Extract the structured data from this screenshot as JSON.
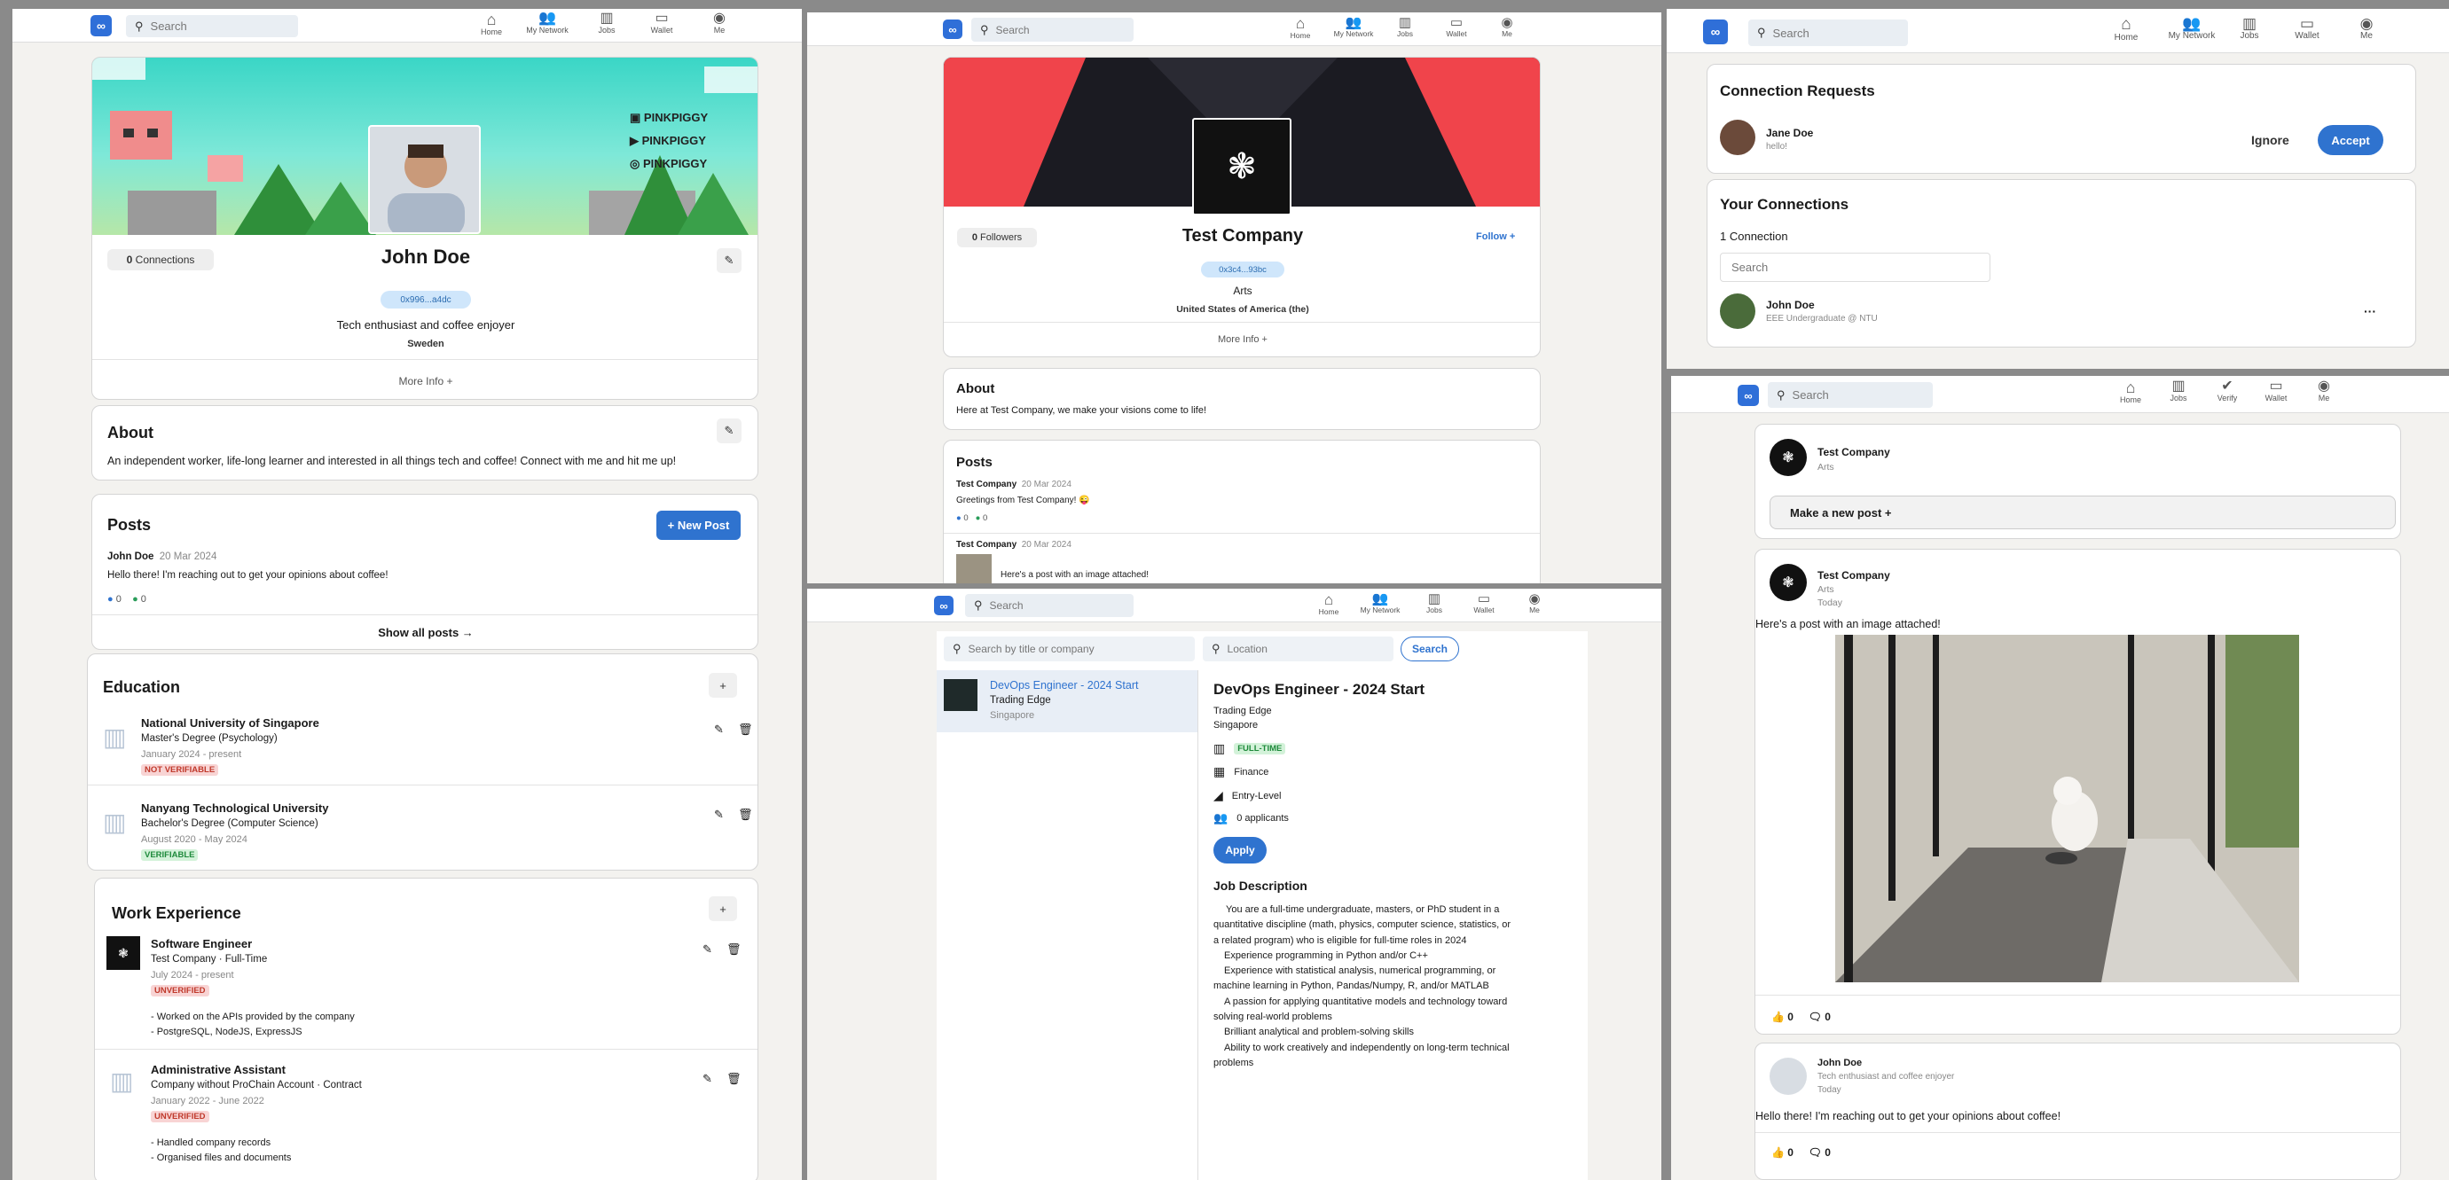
{
  "colors": {
    "brand": "#2f6fd8",
    "accent": "#2f73cf",
    "unverified": "#c0392b",
    "verifiable": "#1e8a3b"
  },
  "nav": {
    "search_placeholder": "Search",
    "home": "Home",
    "network": "My Network",
    "jobs": "Jobs",
    "wallet": "Wallet",
    "me": "Me",
    "verify": "Verify"
  },
  "profile": {
    "connections_count": "0",
    "connections_label": "Connections",
    "name": "John Doe",
    "wallet": "0x996...a4dc",
    "headline": "Tech enthusiast and coffee enjoyer",
    "location": "Sweden",
    "more_info": "More Info +",
    "banner_social": [
      "PINKPIGGY",
      "PINKPIGGY",
      "PINKPIGGY"
    ],
    "about_title": "About",
    "about_text": "An independent worker, life-long learner and interested in all things tech and coffee! Connect with me and hit me up!",
    "posts_title": "Posts",
    "new_post": "+ New Post",
    "post_author": "John Doe",
    "post_date": "20 Mar 2024",
    "post_text": "Hello there! I'm reaching out to get your opinions about coffee!",
    "post_likes": "0",
    "post_comments": "0",
    "show_all": "Show all posts →",
    "education_title": "Education",
    "education": [
      {
        "school": "National University of Singapore",
        "degree": "Master's Degree (Psychology)",
        "dates": "January 2024 - present",
        "status": "NOT VERIFIABLE"
      },
      {
        "school": "Nanyang Technological University",
        "degree": "Bachelor's Degree (Computer Science)",
        "dates": "August 2020 - May 2024",
        "status": "VERIFIABLE"
      }
    ],
    "work_title": "Work Experience",
    "work": [
      {
        "role": "Software Engineer",
        "company": "Test Company · Full-Time",
        "dates": "July 2024 - present",
        "status": "UNVERIFIED",
        "bullets": [
          "- Worked on the APIs provided by the company",
          "- PostgreSQL, NodeJS, ExpressJS"
        ]
      },
      {
        "role": "Administrative Assistant",
        "company": "Company without ProChain Account · Contract",
        "dates": "January 2022 - June 2022",
        "status": "UNVERIFIED",
        "bullets": [
          "- Handled company records",
          "- Organised files and documents"
        ]
      }
    ]
  },
  "company": {
    "followers_count": "0",
    "followers_label": "Followers",
    "name": "Test Company",
    "follow": "Follow +",
    "wallet": "0x3c4...93bc",
    "industry": "Arts",
    "country": "United States of America (the)",
    "more_info": "More Info +",
    "about_title": "About",
    "about_text": "Here at Test Company, we make your visions come to life!",
    "posts_title": "Posts",
    "post1_author": "Test Company",
    "post1_date": "20 Mar 2024",
    "post1_text": "Greetings from Test Company! 😜",
    "post1_likes": "0",
    "post1_comments": "0",
    "post2_author": "Test Company",
    "post2_date": "20 Mar 2024",
    "post2_text": "Here's a post with an image attached!"
  },
  "jobs": {
    "search_placeholder": "Search by title or company",
    "location_placeholder": "Location",
    "search_btn": "Search",
    "list_title": "DevOps Engineer - 2024 Start",
    "list_company": "Trading Edge",
    "list_location": "Singapore",
    "title": "DevOps Engineer - 2024 Start",
    "company": "Trading Edge",
    "location": "Singapore",
    "type": "FULL-TIME",
    "industry": "Finance",
    "level": "Entry-Level",
    "applicants": "0 applicants",
    "apply": "Apply",
    "desc_title": "Job Description",
    "desc_lines": [
      "You are a full-time undergraduate, masters, or PhD student in a",
      "quantitative discipline (math, physics, computer science, statistics, or",
      "a related program) who is eligible for full-time roles in 2024",
      "Experience programming in Python and/or C++",
      "Experience with statistical analysis, numerical programming, or",
      "machine learning in Python, Pandas/Numpy, R, and/or MATLAB",
      "A passion for applying quantitative models and technology toward",
      "solving real-world problems",
      "Brilliant analytical and problem-solving skills",
      "Ability to work creatively and independently on long-term technical",
      "problems"
    ]
  },
  "network": {
    "requests_title": "Connection Requests",
    "req_name": "Jane Doe",
    "req_msg": "hello!",
    "ignore": "Ignore",
    "accept": "Accept",
    "connections_title": "Your Connections",
    "connections_count": "1 Connection",
    "search_placeholder": "Search",
    "conn_name": "John Doe",
    "conn_headline": "EEE Undergraduate @ NTU",
    "more": "···"
  },
  "feed": {
    "new_name": "Test Company",
    "new_sub": "Arts",
    "new_post_btn": "Make a new post +",
    "p1_name": "Test Company",
    "p1_sub": "Arts",
    "p1_time": "Today",
    "p1_text": "Here's a post with an image attached!",
    "p1_likes": "0",
    "p1_comments": "0",
    "p2_name": "John Doe",
    "p2_sub": "Tech enthusiast and coffee enjoyer",
    "p2_time": "Today",
    "p2_text": "Hello there! I'm reaching out to get your opinions about coffee!",
    "p2_likes": "0",
    "p2_comments": "0"
  }
}
